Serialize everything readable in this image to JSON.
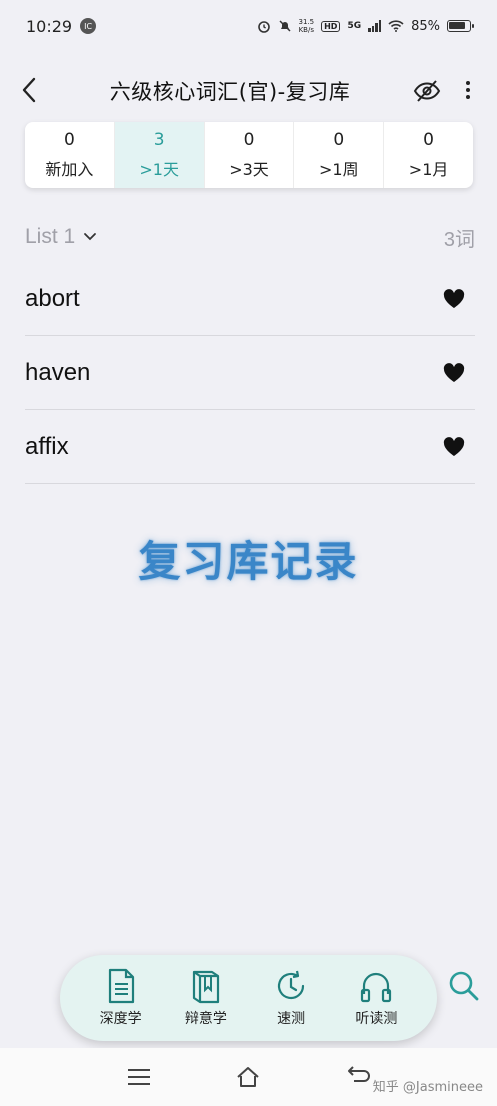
{
  "status_bar": {
    "time": "10:29",
    "notif_badge": "IC",
    "net_speed_value": "31.5",
    "net_speed_unit": "KB/s",
    "hd": "HD",
    "network": "5G",
    "battery": "85%"
  },
  "header": {
    "title": "六级核心词汇(官)-复习库"
  },
  "stages": [
    {
      "count": "0",
      "label": "新加入",
      "active": false
    },
    {
      "count": "3",
      "label": ">1天",
      "active": true
    },
    {
      "count": "0",
      "label": ">3天",
      "active": false
    },
    {
      "count": "0",
      "label": ">1周",
      "active": false
    },
    {
      "count": "0",
      "label": ">1月",
      "active": false
    }
  ],
  "list": {
    "name": "List 1",
    "count": "3词",
    "words": [
      "abort",
      "haven",
      "affix"
    ]
  },
  "watermark": "复习库记录",
  "study_bar": {
    "items": [
      {
        "label": "深度学",
        "icon": "document-icon"
      },
      {
        "label": "辩意学",
        "icon": "book-icon"
      },
      {
        "label": "速测",
        "icon": "timer-icon"
      },
      {
        "label": "听读测",
        "icon": "headphones-icon"
      }
    ]
  },
  "credit": "知乎 @Jasmineee",
  "colors": {
    "accent": "#2a9d9a",
    "active_tab_bg": "#e3f3f3",
    "watermark": "#3a86c8",
    "study_bar_bg": "#e4f3f1"
  }
}
